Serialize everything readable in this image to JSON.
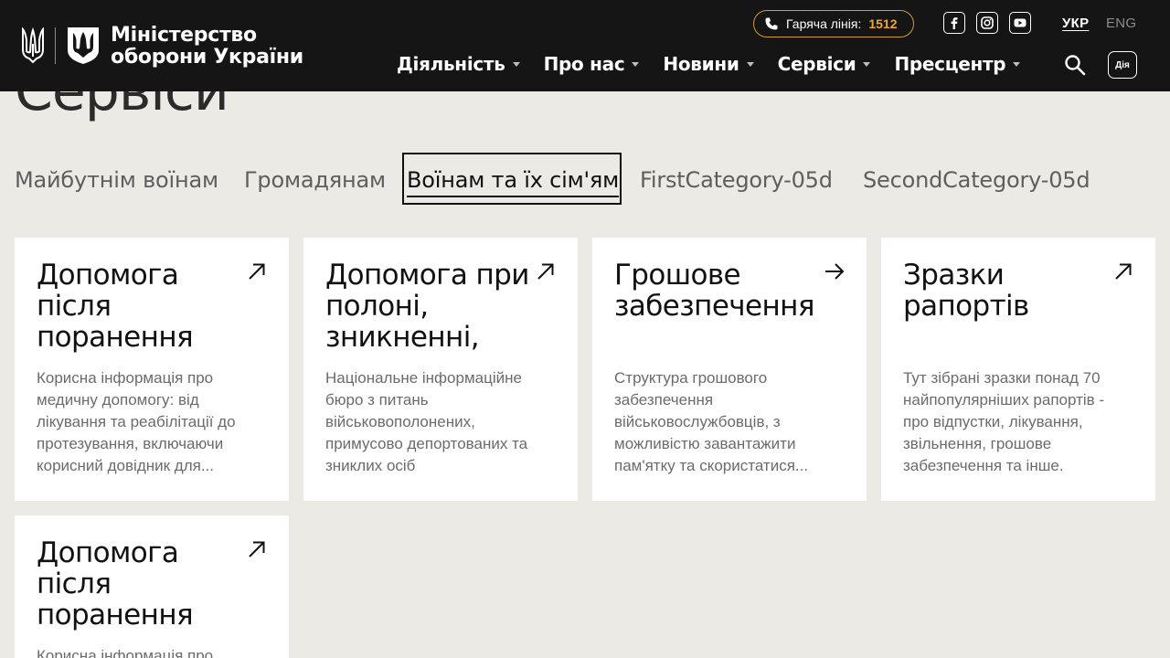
{
  "header": {
    "org_line1": "Міністерство",
    "org_line2": "оборони України",
    "hotline_label": "Гаряча лінія:",
    "hotline_number": "1512",
    "social": [
      "facebook-icon",
      "instagram-icon",
      "youtube-icon"
    ],
    "lang_active": "УКР",
    "lang_inactive": "ENG",
    "nav": [
      "Діяльність",
      "Про нас",
      "Новини",
      "Сервіси",
      "Пресцентр"
    ],
    "diia_label": "Дія"
  },
  "page": {
    "title": "Сервіси"
  },
  "tabs": [
    "Майбутнім воїнам",
    "Громадянам",
    "Воїнам та їх сім'ям",
    "FirstCategory-05d",
    "SecondCategory-05d"
  ],
  "active_tab": "Воїнам та їх сім'ям",
  "cards": [
    {
      "title": "Допомога після поранення",
      "desc": "Корисна інформація про медичну допомогу: від лікування та реабілітації до протезування, включаючи корисний довідник для...",
      "arrow": "arrow-up-right-icon"
    },
    {
      "title": "Допомога при полоні, зникненні,",
      "desc": "Національне інформаційне бюро з питань військовополонених, примусово депортованих та зниклих осіб",
      "arrow": "arrow-up-right-icon"
    },
    {
      "title": "Грошове забезпечення",
      "desc": "Структура грошового забезпечення військовослужбовців, з можливістю завантажити пам'ятку та скористатися...",
      "arrow": "arrow-right-icon"
    },
    {
      "title": "Зразки рапортів",
      "desc": "Тут зібрані зразки понад 70 найпопулярніших рапортів - про відпустки, лікування, звільнення, грошове забезпечення та інше.",
      "arrow": "arrow-up-right-icon"
    },
    {
      "title": "Допомога після поранення",
      "desc": "Корисна інформація про медичну допомогу: від лікування та реабілітації до протезування, включаючи корисний довідник для...",
      "arrow": "arrow-up-right-icon"
    }
  ],
  "colors": {
    "header_bg": "#151515",
    "page_bg": "#eceae5",
    "accent": "#f0a52b"
  }
}
